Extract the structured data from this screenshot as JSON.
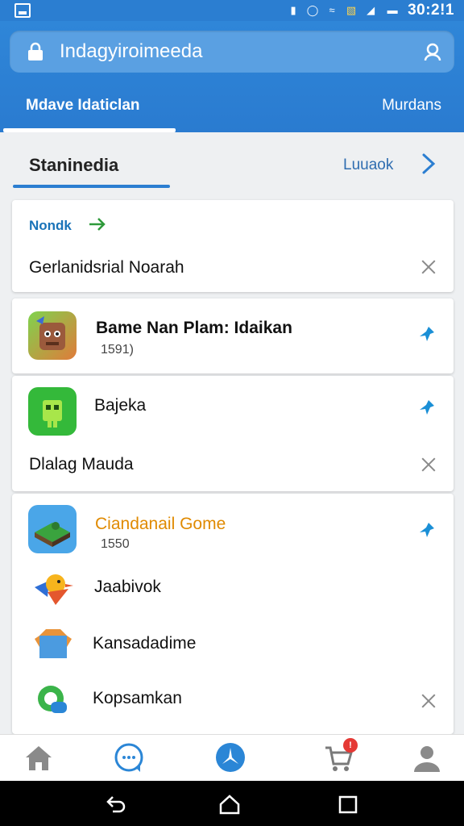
{
  "status_bar": {
    "time": "30:2!1"
  },
  "header": {
    "search_title": "Indagyiroimeeda",
    "tabs": [
      {
        "label": "Mdave Idaticlan"
      },
      {
        "label": "Murdans"
      }
    ]
  },
  "section": {
    "title": "Staninedia",
    "link_label": "Luuaok"
  },
  "card1": {
    "top_label": "Nondk",
    "item_label": "Gerlanidsrial Noarah"
  },
  "card2": {
    "name": "Bame Nan Plam: Idaikan",
    "sub": "1591)"
  },
  "card3": {
    "name": "Bajeka",
    "second": "Dlalag Mauda"
  },
  "card4": {
    "first_name": "Ciandanail Gome",
    "first_sub": "1550",
    "items": [
      {
        "label": "Jaabivok"
      },
      {
        "label": "Kansadadime"
      },
      {
        "label": "Kopsamkan"
      }
    ]
  },
  "bottom_nav": {
    "cart_badge": "!"
  },
  "colors": {
    "primary": "#2b7ed1",
    "accent_orange": "#e08a00",
    "link_blue": "#1a73b8"
  }
}
